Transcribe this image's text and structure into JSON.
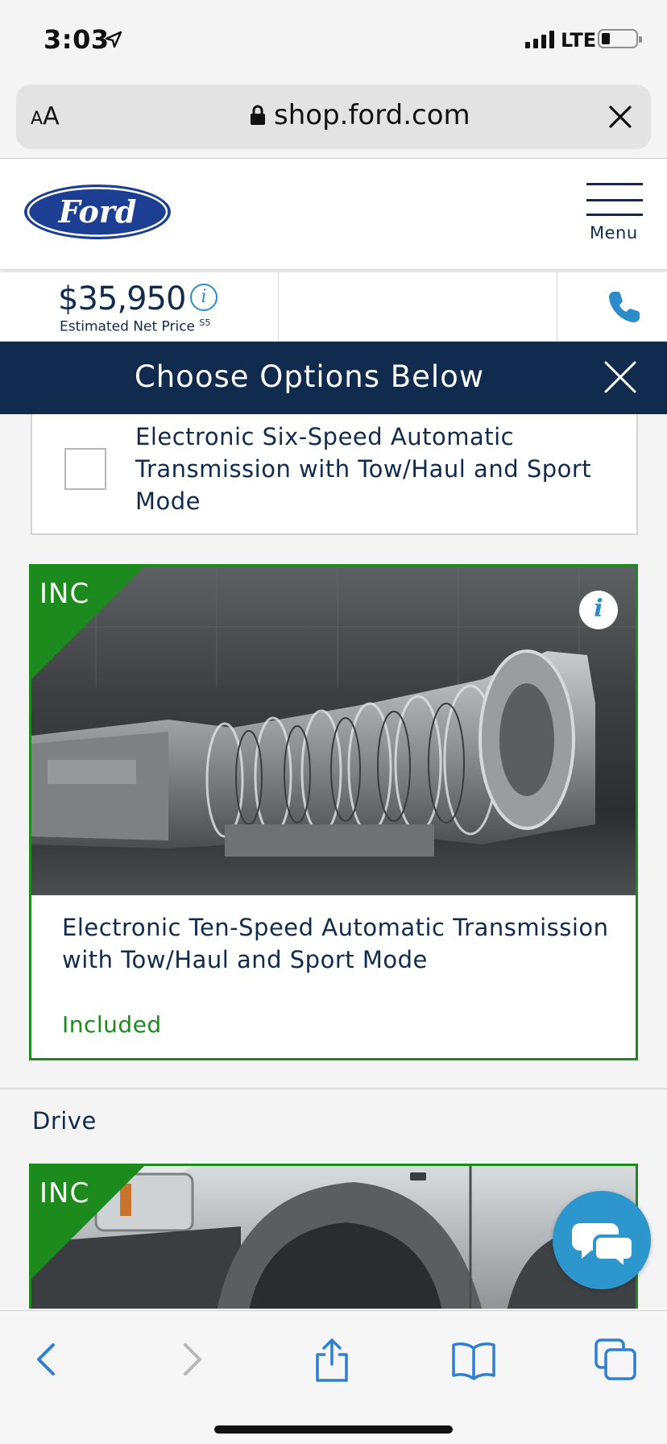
{
  "status_bar": {
    "time": "3:03",
    "network": "LTE",
    "battery_level": 0.25
  },
  "browser": {
    "text_size_small": "A",
    "text_size_large": "A",
    "url": "shop.ford.com"
  },
  "header": {
    "logo_text": "Ford",
    "menu_label": "Menu"
  },
  "price": {
    "value": "$35,950",
    "label": "Estimated Net Price",
    "footnote": "S5",
    "info_glyph": "i"
  },
  "options_banner": {
    "title": "Choose Options Below"
  },
  "options": [
    {
      "title": "Electronic Six-Speed Automatic Transmission with Tow/Haul and Sport Mode",
      "checked": false
    },
    {
      "badge": "INC",
      "title": "Electronic Ten-Speed Automatic Transmission with Tow/Haul and Sport Mode",
      "status": "Included",
      "info_glyph": "i"
    }
  ],
  "sections": {
    "drive": {
      "title": "Drive",
      "badge": "INC"
    }
  },
  "colors": {
    "navy": "#102b4e",
    "green": "#1d8a1d",
    "blue": "#2e8bc9"
  }
}
